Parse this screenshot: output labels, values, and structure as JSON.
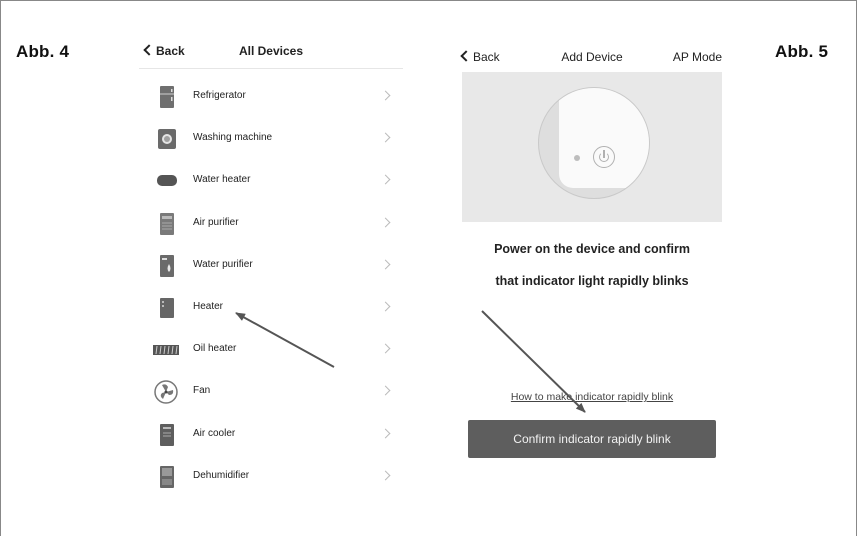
{
  "figures": {
    "left_label": "Abb. 4",
    "right_label": "Abb. 5"
  },
  "all_devices": {
    "back_label": "Back",
    "title": "All Devices",
    "items": [
      {
        "label": "Refrigerator",
        "icon": "refrigerator-icon"
      },
      {
        "label": "Washing machine",
        "icon": "washing-machine-icon"
      },
      {
        "label": "Water heater",
        "icon": "water-heater-icon"
      },
      {
        "label": "Air purifier",
        "icon": "air-purifier-icon"
      },
      {
        "label": "Water purifier",
        "icon": "water-purifier-icon"
      },
      {
        "label": "Heater",
        "icon": "heater-icon"
      },
      {
        "label": "Oil heater",
        "icon": "oil-heater-icon"
      },
      {
        "label": "Fan",
        "icon": "fan-icon"
      },
      {
        "label": "Air cooler",
        "icon": "air-cooler-icon"
      },
      {
        "label": "Dehumidifier",
        "icon": "dehumidifier-icon"
      }
    ]
  },
  "add_device": {
    "back_label": "Back",
    "title": "Add Device",
    "mode_label": "AP Mode",
    "instruction_line1": "Power on the device and confirm",
    "instruction_line2": "that indicator light rapidly blinks",
    "help_link": "How to make indicator rapidly blink",
    "confirm_button": "Confirm indicator rapidly blink"
  },
  "colors": {
    "button_bg": "#5e5e5e",
    "hero_bg": "#e8e8e8",
    "arrow": "#555555"
  }
}
